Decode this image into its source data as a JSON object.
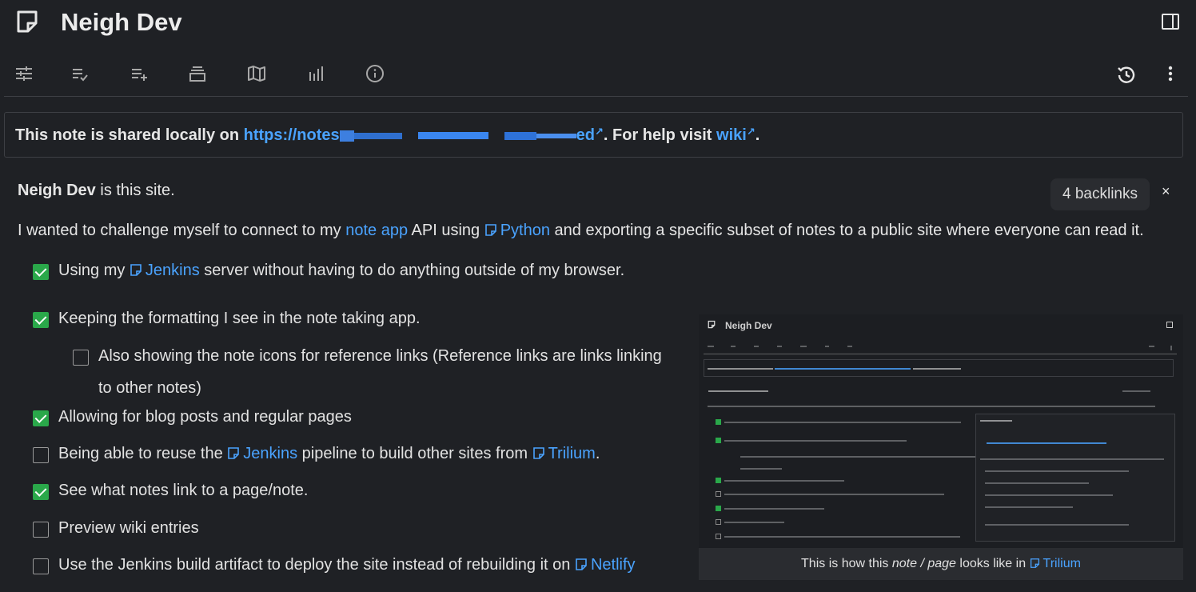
{
  "app": {
    "title": "Neigh Dev"
  },
  "toolbar": {
    "buttons": [
      "options-icon",
      "checklist-icon",
      "add-list-icon",
      "stack-icon",
      "map-icon",
      "chart-icon",
      "info-icon"
    ],
    "right": [
      "history-icon",
      "more-icon"
    ]
  },
  "share": {
    "prefix": "This note is shared locally on",
    "url_start": "https://notes",
    "url_end": "ed",
    "mid": ". For help visit",
    "wiki": "wiki",
    "end": "."
  },
  "intro": {
    "name": "Neigh Dev",
    "rest": "is this site."
  },
  "backlinks": {
    "label": "4 backlinks",
    "close": "×"
  },
  "para": {
    "t1": "I wanted to challenge myself to connect to my",
    "link1": "note app",
    "t2": "API using",
    "link2": "Python",
    "t3": "and exporting a specific subset of notes to a public site where everyone can read it."
  },
  "tasks": [
    {
      "checked": true,
      "a": "Using my",
      "link": "Jenkins",
      "b": "server without having to do anything outside of my browser."
    },
    {
      "checked": true,
      "a": "Keeping the formatting I see in the note taking app."
    },
    {
      "checked": false,
      "a": "Also showing the note icons for reference links (Reference links are links linking",
      "b": "to other notes)"
    },
    {
      "checked": true,
      "a": "Allowing for blog posts and regular pages"
    },
    {
      "checked": false,
      "a": "Being able to reuse the",
      "link": "Jenkins",
      "b": "pipeline to build other sites from",
      "link2": "Trilium",
      "c": "."
    },
    {
      "checked": true,
      "a": "See what notes link to a page/note."
    },
    {
      "checked": false,
      "a": "Preview wiki entries"
    },
    {
      "checked": false,
      "a": "Use the Jenkins build artifact to deploy the site instead of rebuilding it on",
      "link": "Netlify"
    }
  ],
  "preview": {
    "mini_title": "Neigh Dev",
    "caption_a": "This is how this",
    "caption_em": "note / page",
    "caption_b": "looks like in",
    "caption_link": "Trilium"
  },
  "colors": {
    "background": "#1f2125",
    "link": "#4aa3ff",
    "checked": "#2aa84a"
  }
}
